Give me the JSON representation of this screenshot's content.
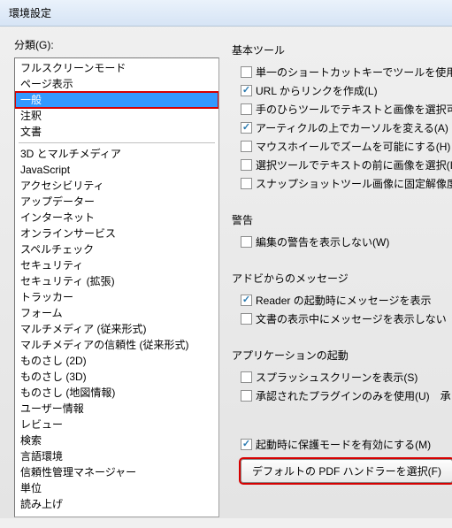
{
  "window": {
    "title": "環境設定"
  },
  "left": {
    "label": "分類(G):",
    "items_top": [
      "フルスクリーンモード",
      "ページ表示",
      "一般",
      "注釈",
      "文書"
    ],
    "selected_index": 2,
    "items_bottom": [
      "3D とマルチメディア",
      "JavaScript",
      "アクセシビリティ",
      "アップデーター",
      "インターネット",
      "オンラインサービス",
      "スペルチェック",
      "セキュリティ",
      "セキュリティ (拡張)",
      "トラッカー",
      "フォーム",
      "マルチメディア (従来形式)",
      "マルチメディアの信頼性 (従来形式)",
      "ものさし (2D)",
      "ものさし (3D)",
      "ものさし (地図情報)",
      "ユーザー情報",
      "レビュー",
      "検索",
      "言語環境",
      "信頼性管理マネージャー",
      "単位",
      "読み上げ"
    ]
  },
  "right": {
    "sections": {
      "basic": {
        "title": "基本ツール",
        "opts": [
          {
            "label": "単一のショートカットキーでツールを使用",
            "checked": false
          },
          {
            "label": "URL からリンクを作成(L)",
            "checked": true
          },
          {
            "label": "手のひらツールでテキストと画像を選択可",
            "checked": false
          },
          {
            "label": "アーティクルの上でカーソルを変える(A)",
            "checked": true
          },
          {
            "label": "マウスホイールでズームを可能にする(H)",
            "checked": false
          },
          {
            "label": "選択ツールでテキストの前に画像を選択(I)",
            "checked": false
          },
          {
            "label": "スナップショットツール画像に固定解像度",
            "checked": false
          }
        ]
      },
      "warn": {
        "title": "警告",
        "opts": [
          {
            "label": "編集の警告を表示しない(W)",
            "checked": false
          }
        ]
      },
      "adobe": {
        "title": "アドビからのメッセージ",
        "opts": [
          {
            "label": "Reader の起動時にメッセージを表示",
            "checked": true
          },
          {
            "label": "文書の表示中にメッセージを表示しない",
            "checked": false
          }
        ]
      },
      "app": {
        "title": "アプリケーションの起動",
        "opts": [
          {
            "label": "スプラッシュスクリーンを表示(S)",
            "checked": false
          },
          {
            "label": "承認されたプラグインのみを使用(U)　承",
            "checked": false
          }
        ]
      },
      "protect": {
        "opts": [
          {
            "label": "起動時に保護モードを有効にする(M)",
            "checked": true
          }
        ]
      },
      "button": {
        "label": "デフォルトの PDF ハンドラーを選択(F)"
      }
    }
  }
}
